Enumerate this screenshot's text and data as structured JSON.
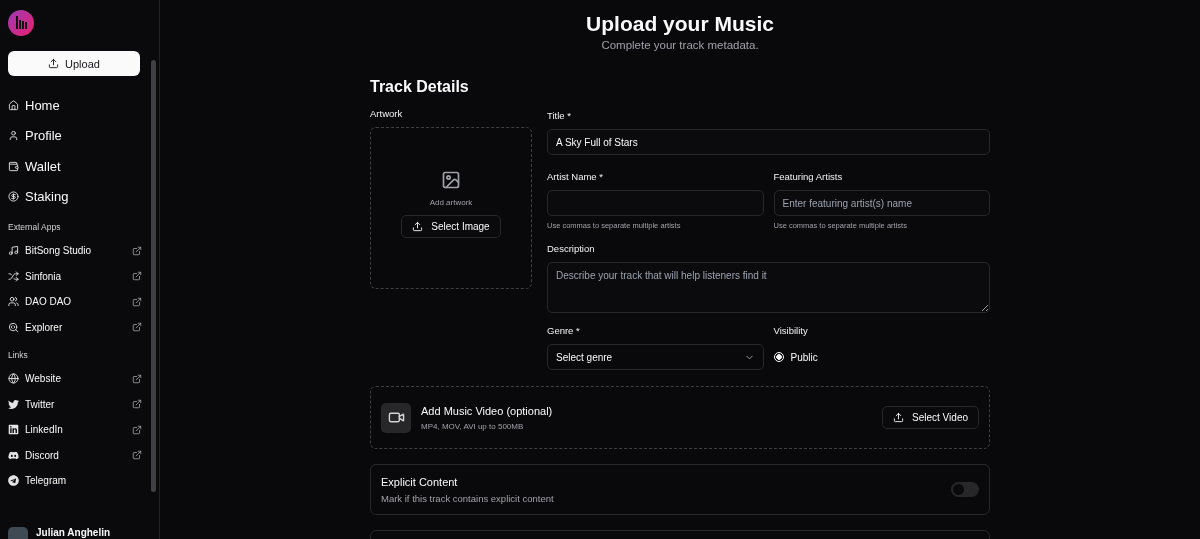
{
  "sidebar": {
    "upload_button": "Upload",
    "nav": [
      {
        "label": "Home"
      },
      {
        "label": "Profile"
      },
      {
        "label": "Wallet"
      },
      {
        "label": "Staking"
      }
    ],
    "sections": [
      {
        "title": "External Apps",
        "items": [
          {
            "label": "BitSong Studio",
            "external": true
          },
          {
            "label": "Sinfonia",
            "external": true
          },
          {
            "label": "DAO DAO",
            "external": true
          },
          {
            "label": "Explorer",
            "external": true
          }
        ]
      },
      {
        "title": "Links",
        "items": [
          {
            "label": "Website",
            "external": true
          },
          {
            "label": "Twitter",
            "external": true
          },
          {
            "label": "LinkedIn",
            "external": true
          },
          {
            "label": "Discord",
            "external": true
          },
          {
            "label": "Telegram",
            "external": false
          }
        ]
      }
    ],
    "user": {
      "name": "Julian Anghelin"
    }
  },
  "main": {
    "title": "Upload your Music",
    "subtitle": "Complete your track metadata.",
    "section_title": "Track Details",
    "artwork": {
      "label": "Artwork",
      "hint": "Add artwork",
      "button": "Select Image"
    },
    "title_field": {
      "label": "Title *",
      "value": "A Sky Full of Stars"
    },
    "artist_field": {
      "label": "Artist Name *",
      "hint": "Use commas to separate multiple artists"
    },
    "featuring_field": {
      "label": "Featuring Artists",
      "placeholder": "Enter featuring artist(s) name",
      "hint": "Use commas to separate multiple artists"
    },
    "description_field": {
      "label": "Description",
      "placeholder": "Describe your track that will help listeners find it"
    },
    "genre_field": {
      "label": "Genre *",
      "value": "Select genre"
    },
    "visibility": {
      "label": "Visibility",
      "options": [
        {
          "label": "Public",
          "selected": true
        }
      ]
    },
    "video": {
      "title": "Add Music Video (optional)",
      "hint": "MP4, MOV, AVI up to 500MB",
      "button": "Select Video"
    },
    "explicit": {
      "title": "Explicit Content",
      "description": "Mark if this track contains explicit content",
      "on": false
    }
  }
}
